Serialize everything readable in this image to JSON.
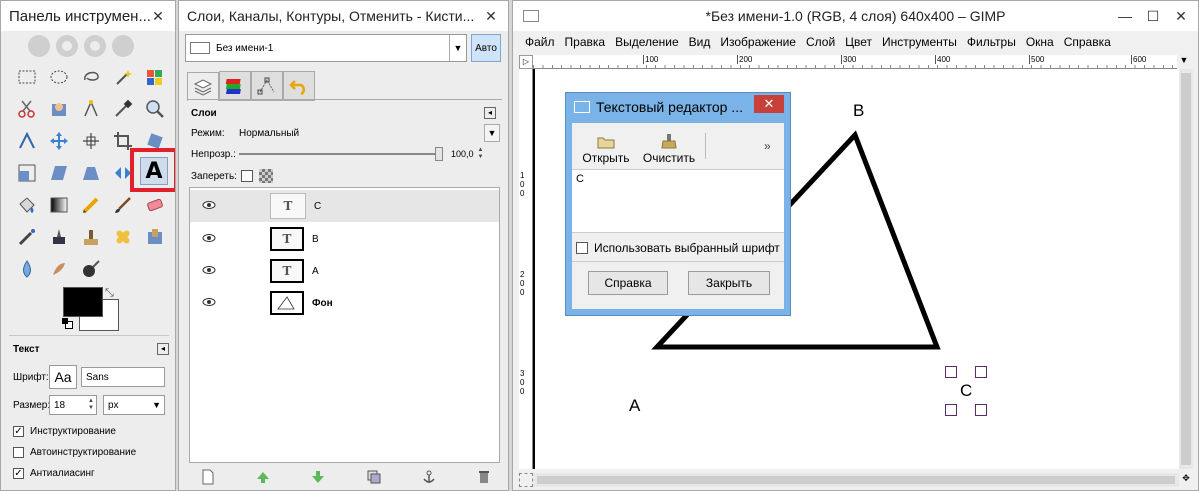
{
  "toolbox": {
    "title": "Панель инструмен...",
    "text_options": {
      "header": "Текст",
      "font_label": "Шрифт:",
      "font_preview": "Aa",
      "font_value": "Sans",
      "size_label": "Размер:",
      "size_value": "18",
      "unit_value": "px",
      "hinting_label": "Инструктирование",
      "autohint_label": "Автоинструктирование",
      "antialias_label": "Антиалиасинг"
    }
  },
  "layers_dock": {
    "title": "Слои, Каналы, Контуры, Отменить - Кисти...",
    "image_selector": "Без имени-1",
    "auto_button": "Авто",
    "panel_title": "Слои",
    "mode_label": "Режим:",
    "mode_value": "Нормальный",
    "opacity_label": "Непрозр.:",
    "opacity_value": "100,0",
    "lock_label": "Запереть:",
    "layers": [
      {
        "name": "C",
        "bold": false
      },
      {
        "name": "B",
        "bold": false
      },
      {
        "name": "A",
        "bold": false
      },
      {
        "name": "Фон",
        "bold": true
      }
    ]
  },
  "image_window": {
    "title": "*Без имени-1.0 (RGB, 4 слоя) 640x400 – GIMP",
    "menu": [
      "Файл",
      "Правка",
      "Выделение",
      "Вид",
      "Изображение",
      "Слой",
      "Цвет",
      "Инструменты",
      "Фильтры",
      "Окна",
      "Справка"
    ],
    "ruler_h": [
      "100",
      "200",
      "300",
      "400",
      "500",
      "600"
    ],
    "ruler_v": [
      "100",
      "200",
      "300"
    ],
    "canvas_labels": {
      "a": "A",
      "b": "B",
      "c": "C"
    }
  },
  "text_editor": {
    "title": "Текстовый редактор ...",
    "open_button": "Открыть",
    "clear_button": "Очистить",
    "more": "»",
    "content": "C",
    "use_font_label": "Использовать выбранный шрифт",
    "help_button": "Справка",
    "close_button": "Закрыть"
  },
  "colors": {
    "highlight": "#e0202a",
    "accent": "#4a90d9",
    "fg_color": "#000000",
    "bg_color": "#ffffff"
  }
}
